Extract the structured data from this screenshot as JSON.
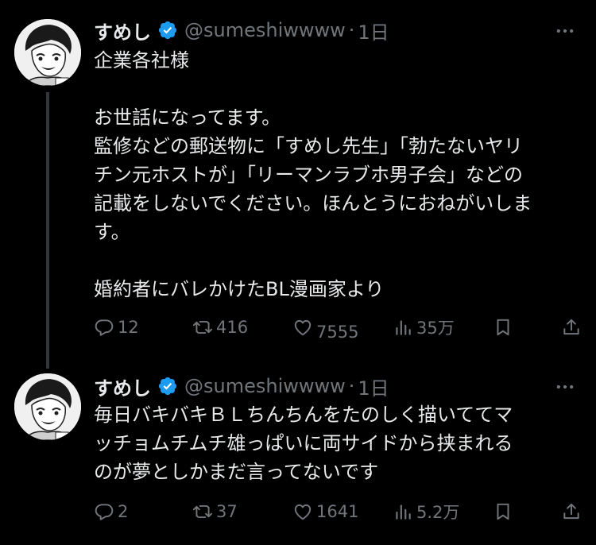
{
  "tweets": [
    {
      "author": {
        "display_name": "すめし",
        "handle": "@sumeshiwwww",
        "verified": true
      },
      "separator": "·",
      "time": "1日",
      "text_lines": [
        "企業各社様",
        "",
        "お世話になってます。",
        "監修などの郵送物に「すめし先生」「勃たないヤリ",
        "チン元ホストが」「リーマンラブホ男子会」などの",
        "記載をしないでください。ほんとうにおねがいしま",
        "す。",
        "",
        "婚約者にバレかけたBL漫画家より"
      ],
      "stats": {
        "replies": "12",
        "retweets": "416",
        "likes": "7555",
        "views": "35万"
      }
    },
    {
      "author": {
        "display_name": "すめし",
        "handle": "@sumeshiwwww",
        "verified": true
      },
      "separator": "·",
      "time": "1日",
      "text_lines": [
        "毎日バキバキＢＬちんちんをたのしく描いててマ",
        "ッチョムチムチ雄っぱいに両サイドから挟まれる",
        "のが夢としかまだ言ってないです"
      ],
      "stats": {
        "replies": "2",
        "retweets": "37",
        "likes": "1641",
        "views": "5.2万"
      }
    }
  ],
  "icons": {
    "verified": "verified-badge-icon",
    "more": "more-options-icon",
    "reply": "reply-icon",
    "retweet": "retweet-icon",
    "like": "heart-icon",
    "views": "views-chart-icon",
    "bookmark": "bookmark-icon",
    "share": "share-icon"
  },
  "colors": {
    "background": "#000000",
    "text_primary": "#e7e9ea",
    "text_secondary": "#71767b",
    "verified_blue": "#1d9bf0",
    "thread_line": "#333639"
  }
}
